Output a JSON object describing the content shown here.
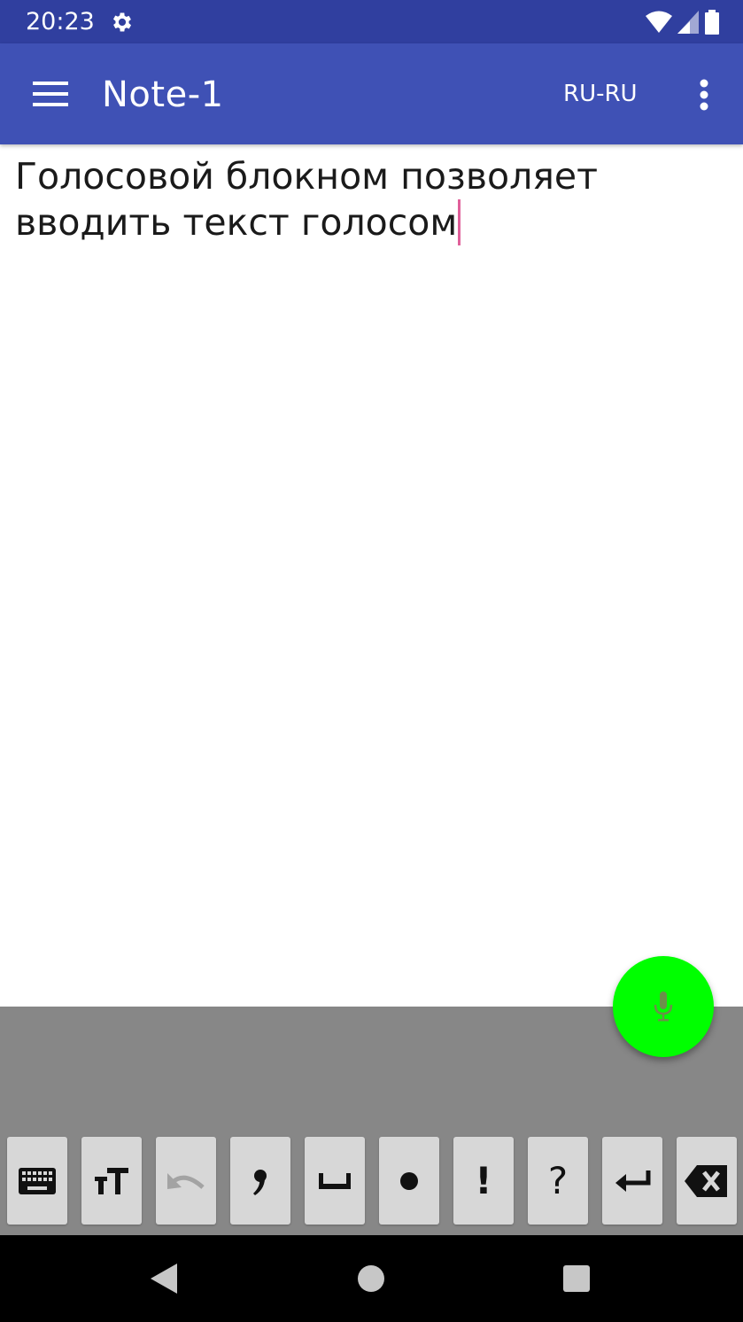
{
  "status_bar": {
    "time": "20:23",
    "icons": [
      "settings-gear-icon",
      "wifi-icon",
      "signal-icon",
      "battery-icon"
    ]
  },
  "app_bar": {
    "title": "Note-1",
    "language": "RU-RU",
    "color": "#3f51b5",
    "status_color": "#303f9f"
  },
  "note": {
    "text": "Голосовой блокном позволяет вводить текст голосом"
  },
  "toolbar": {
    "keys": [
      {
        "name": "keyboard-key",
        "icon": "keyboard-icon"
      },
      {
        "name": "text-size-key",
        "icon": "text-size-icon"
      },
      {
        "name": "undo-key",
        "icon": "undo-icon"
      },
      {
        "name": "comma-key",
        "icon": "comma-icon"
      },
      {
        "name": "space-key",
        "icon": "space-icon"
      },
      {
        "name": "period-key",
        "icon": "period-icon"
      },
      {
        "name": "exclamation-key",
        "label": "!"
      },
      {
        "name": "question-key",
        "label": "?"
      },
      {
        "name": "enter-key",
        "icon": "enter-icon"
      },
      {
        "name": "backspace-key",
        "icon": "backspace-icon"
      }
    ],
    "panel_color": "#878787"
  },
  "fab": {
    "icon": "microphone-icon",
    "color": "#00ff00"
  },
  "nav_bar": {
    "icons": [
      "back-icon",
      "home-icon",
      "recents-icon"
    ]
  }
}
